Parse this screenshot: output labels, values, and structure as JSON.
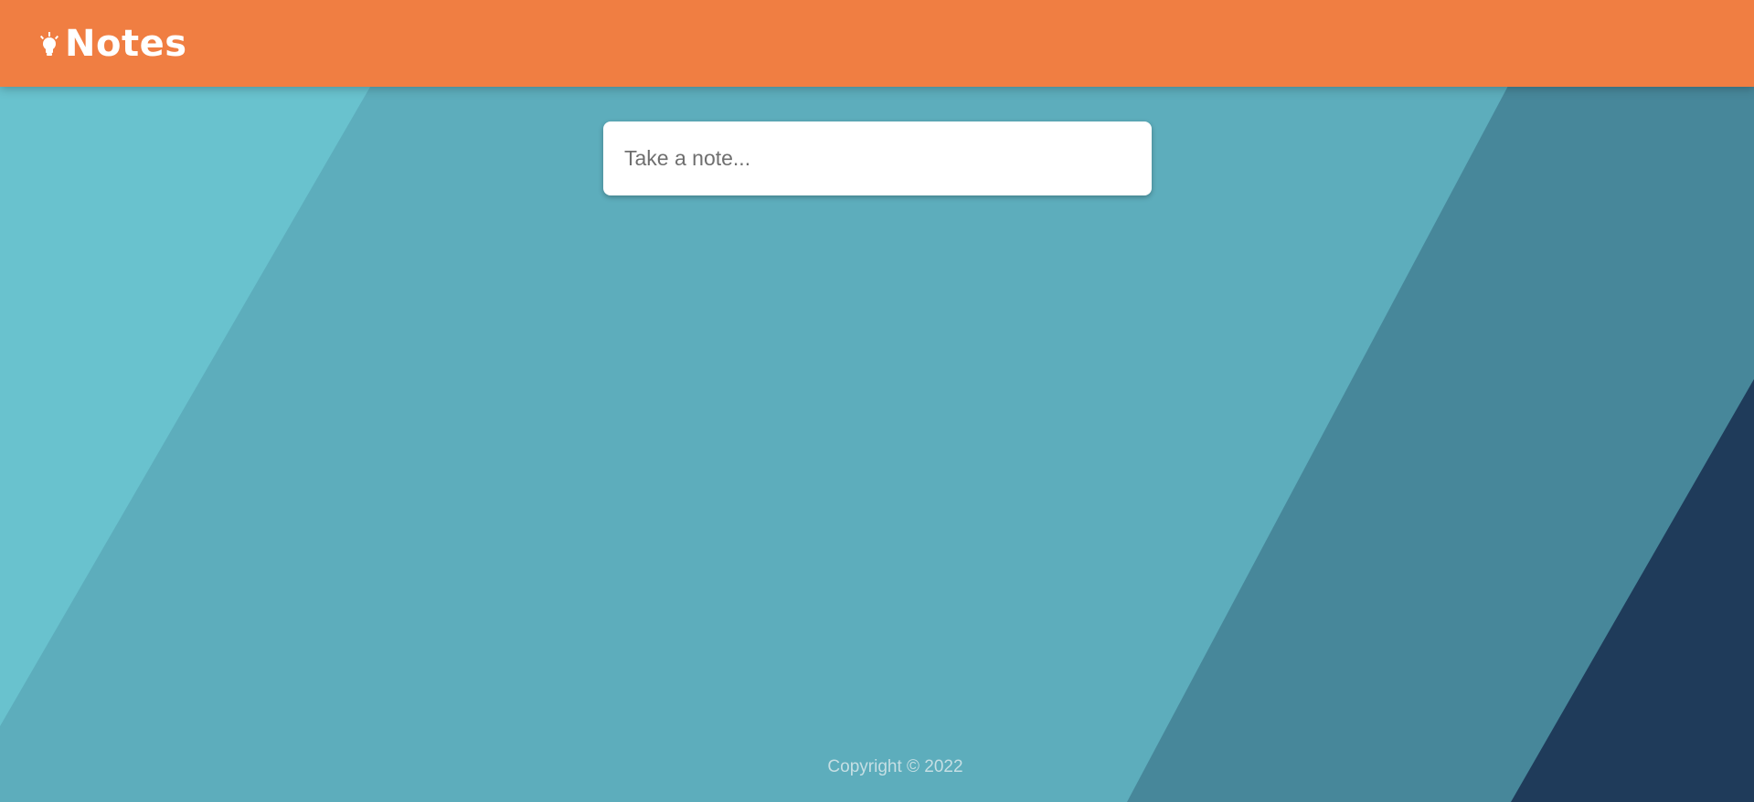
{
  "app": {
    "title": "Notes",
    "icon": "lightbulb-icon"
  },
  "note_form": {
    "placeholder": "Take a note...",
    "value": ""
  },
  "footer": {
    "copyright": "Copyright © 2022"
  },
  "colors": {
    "header": "#f07e42",
    "background_light": "#69c2ce",
    "background_mid": "#5dadbc",
    "background_dark": "#47879a",
    "background_darkest": "#1f3b5a",
    "footer_text": "#c6dfe4"
  }
}
